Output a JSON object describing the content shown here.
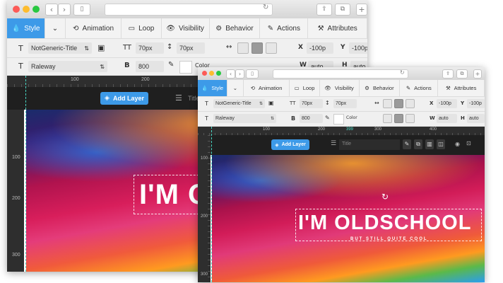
{
  "tabs": [
    {
      "icon": "💧",
      "label": "Style",
      "active": true
    },
    {
      "icon": "⌄",
      "label": ""
    },
    {
      "icon": "⟲",
      "label": "Animation"
    },
    {
      "icon": "▭",
      "label": "Loop"
    },
    {
      "icon": "👁",
      "label": "Visibility"
    },
    {
      "icon": "⚙",
      "label": "Behavior"
    },
    {
      "icon": "✎",
      "label": "Actions"
    },
    {
      "icon": "⚒",
      "label": "Attributes"
    }
  ],
  "row1": {
    "font_label_icon": "T",
    "style_select": "NotGeneric-Title",
    "size_icon": "TT",
    "font_size": "70px",
    "line_height_icon": "↕",
    "line_height": "70px",
    "x_label": "X",
    "x_value": "-100p",
    "y_label": "Y",
    "y_value": "-100p"
  },
  "row2": {
    "font_icon": "T",
    "font_family": "Raleway",
    "weight_icon": "B",
    "font_weight": "800",
    "color_label": "Color",
    "w_label": "W",
    "w_value": "auto",
    "h_label": "H",
    "h_value": "auto"
  },
  "ruler_back": [
    "100",
    "200"
  ],
  "ruler_front": [
    "100",
    "200",
    "300",
    "399",
    "400"
  ],
  "vruler_back": [
    "100",
    "200",
    "300"
  ],
  "vruler_front": [
    "100",
    "200",
    "300"
  ],
  "add_layer_label": "Add Layer",
  "layer_title_placeholder": "Title",
  "title_back": "I'M OL",
  "title_front": "I'M OLDSCHOOL",
  "subtitle_front": "BUT STILL QUITE COOL",
  "colors": {
    "accent": "#3d9ae8"
  }
}
